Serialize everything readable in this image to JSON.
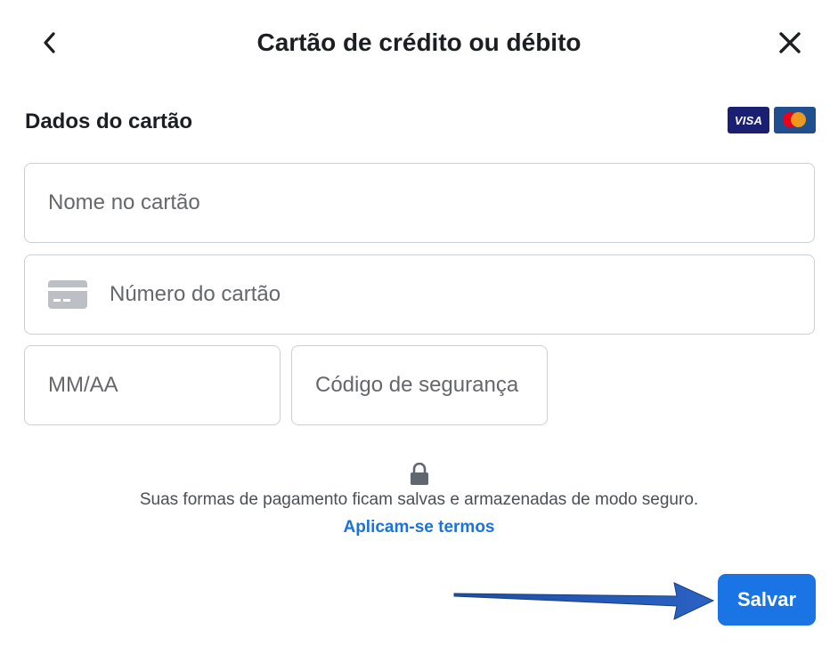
{
  "header": {
    "title": "Cartão de crédito ou débito",
    "back_icon": "chevron-left-icon",
    "close_icon": "close-icon"
  },
  "card_section": {
    "title": "Dados do cartão",
    "logos": {
      "visa": "VISA",
      "mastercard_icon": "mastercard-logo"
    }
  },
  "form": {
    "name": {
      "placeholder": "Nome no cartão",
      "value": ""
    },
    "number": {
      "placeholder": "Número do cartão",
      "value": "",
      "icon": "credit-card-icon"
    },
    "expiry": {
      "placeholder": "MM/AA",
      "value": ""
    },
    "cvv": {
      "placeholder": "Código de segurança",
      "value": ""
    }
  },
  "footer": {
    "lock_icon": "lock-icon",
    "secure_text": "Suas formas de pagamento ficam salvas e armazenadas de modo seguro.",
    "terms_link": "Aplicam-se termos",
    "save_label": "Salvar"
  },
  "colors": {
    "primary": "#1b74e4",
    "link": "#1a73d9",
    "border": "#ccd0d5",
    "text": "#1c1e21",
    "muted": "#65676b",
    "arrow": "#1f4fa3"
  }
}
